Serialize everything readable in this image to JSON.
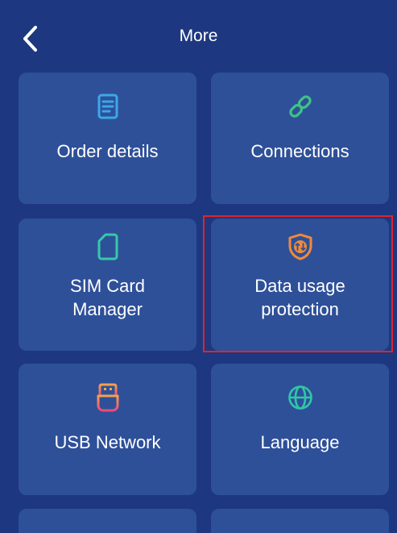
{
  "header": {
    "title": "More",
    "back_icon": "chevron-left-icon"
  },
  "tiles": [
    {
      "label": "Order details",
      "icon": "document-icon",
      "icon_color": "#3ba8e8"
    },
    {
      "label": "Connections",
      "icon": "link-icon",
      "icon_color": "#3fc286"
    },
    {
      "label": "SIM Card\nManager",
      "icon": "sim-card-icon",
      "icon_color": "#37c9a8"
    },
    {
      "label": "Data usage\nprotection",
      "icon": "shield-data-icon",
      "icon_color": "#f08a3a"
    },
    {
      "label": "USB Network",
      "icon": "usb-icon",
      "icon_color": "#f0605c"
    },
    {
      "label": "Language",
      "icon": "globe-icon",
      "icon_color": "#2fc7a6"
    }
  ],
  "colors": {
    "background": "#1d3880",
    "tile": "#2e5099",
    "highlight": "#e0242a"
  }
}
